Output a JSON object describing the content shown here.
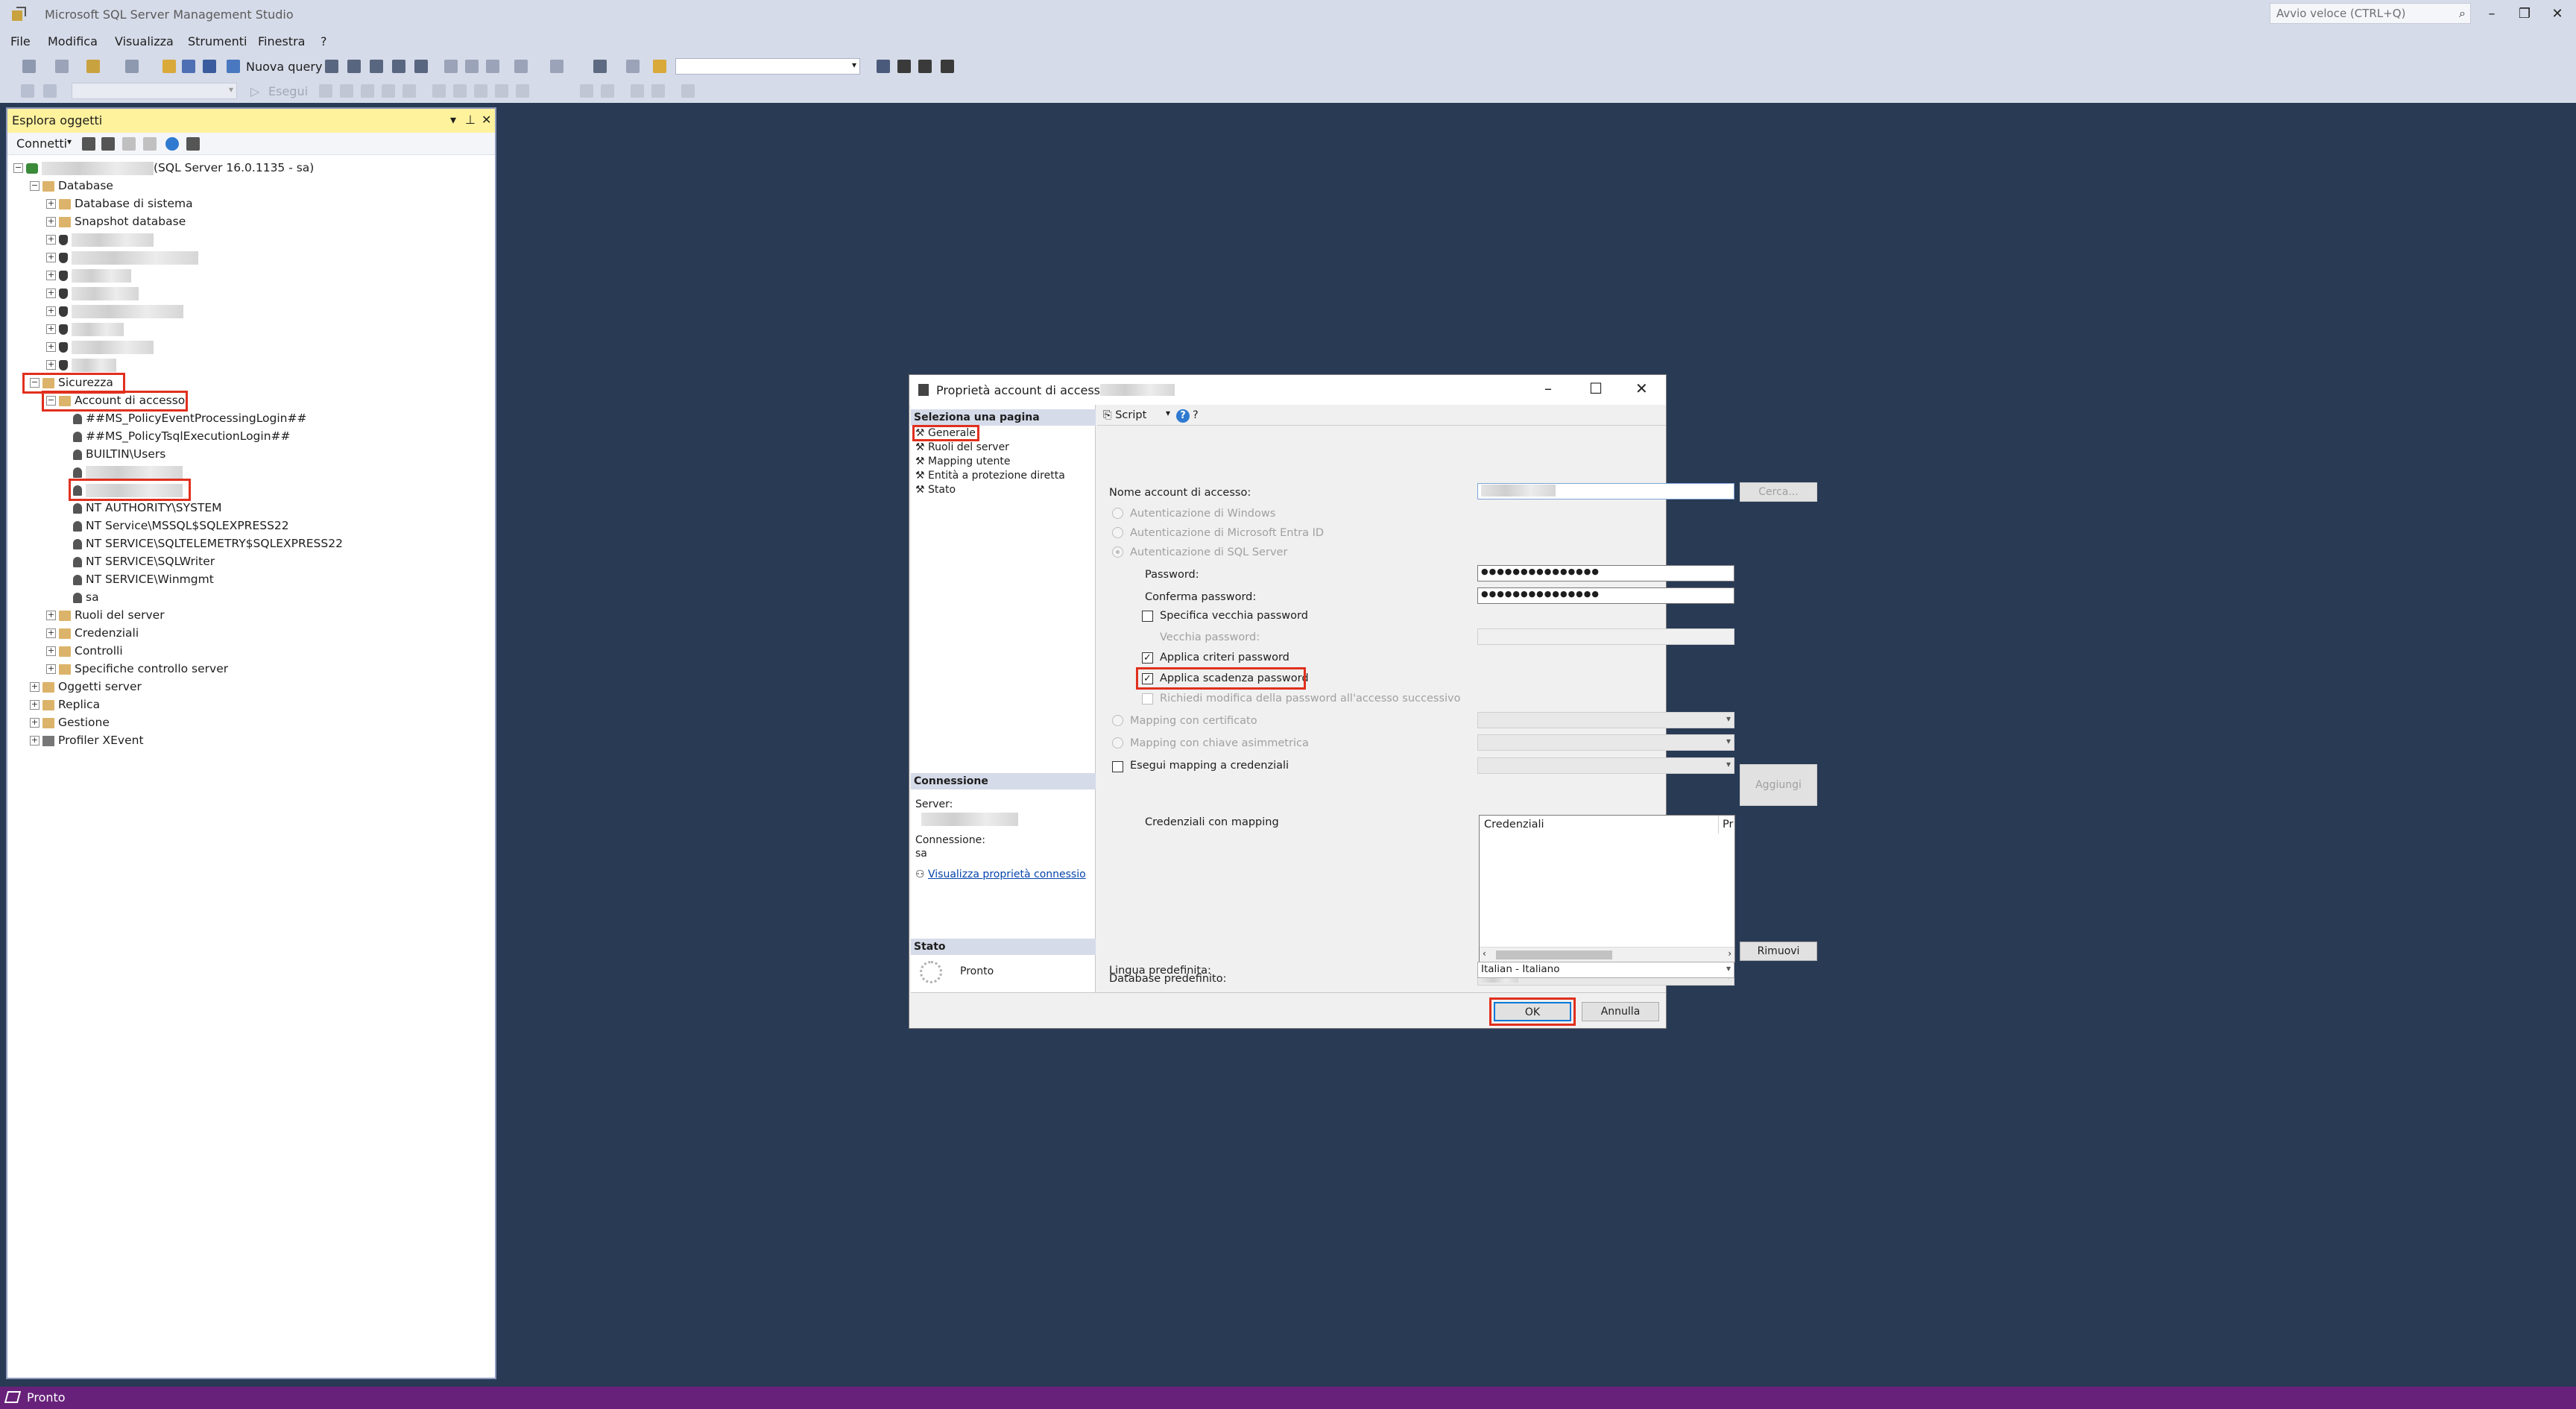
{
  "window": {
    "title": "Microsoft SQL Server Management Studio",
    "quick_launch_placeholder": "Avvio veloce (CTRL+Q)"
  },
  "menu": [
    "File",
    "Modifica",
    "Visualizza",
    "Strumenti",
    "Finestra",
    "?"
  ],
  "toolbar": {
    "new_query": "Nuova query",
    "execute": "Esegui"
  },
  "object_explorer": {
    "title": "Esplora oggetti",
    "connect": "Connetti",
    "server_suffix": "(SQL Server 16.0.1135 - sa)",
    "databases": "Database",
    "system_databases": "Database di sistema",
    "snapshot_databases": "Snapshot database",
    "security": "Sicurezza",
    "logins": "Account di accesso",
    "login_items": [
      "##MS_PolicyEventProcessingLogin##",
      "##MS_PolicyTsqlExecutionLogin##",
      "BUILTIN\\Users",
      "NT AUTHORITY\\SYSTEM",
      "NT Service\\MSSQL$SQLEXPRESS22",
      "NT SERVICE\\SQLTELEMETRY$SQLEXPRESS22",
      "NT SERVICE\\SQLWriter",
      "NT SERVICE\\Winmgmt",
      "sa"
    ],
    "security_children": [
      "Ruoli del server",
      "Credenziali",
      "Controlli",
      "Specifiche controllo server"
    ],
    "top_nodes": [
      "Oggetti server",
      "Replica",
      "Gestione",
      "Profiler XEvent"
    ]
  },
  "status_bar": "Pronto",
  "dialog": {
    "title": "Proprietà account di accesso -",
    "select_page": "Seleziona una pagina",
    "pages": [
      "Generale",
      "Ruoli del server",
      "Mapping utente",
      "Entità a protezione diretta",
      "Stato"
    ],
    "connection_header": "Connessione",
    "server_label": "Server:",
    "connection_label": "Connessione:",
    "connection_value": "sa",
    "view_props_link": "Visualizza proprietà connessio",
    "state_header": "Stato",
    "state_value": "Pronto",
    "script": "Script",
    "login_name_label": "Nome account di accesso:",
    "search_button": "Cerca...",
    "auth_windows": "Autenticazione di Windows",
    "auth_entra": "Autenticazione di Microsoft Entra ID",
    "auth_sql": "Autenticazione di SQL Server",
    "password_label": "Password:",
    "password_value": "●●●●●●●●●●●●●●●",
    "confirm_label": "Conferma password:",
    "confirm_value": "●●●●●●●●●●●●●●●",
    "specify_old": "Specifica vecchia password",
    "old_password": "Vecchia password:",
    "enforce_policy": "Applica criteri password",
    "enforce_expiration": "Applica scadenza password",
    "must_change": "Richiedi modifica della password all'accesso successivo",
    "mapped_cert": "Mapping con certificato",
    "mapped_key": "Mapping con chiave asimmetrica",
    "map_credential": "Esegui mapping a credenziali",
    "add_button": "Aggiungi",
    "mapped_credentials_label": "Credenziali con mapping",
    "grid_col1": "Credenziali",
    "grid_col2": "Pr",
    "remove_button": "Rimuovi",
    "default_db_label": "Database predefinito:",
    "default_lang_label": "Lingua predefinita:",
    "default_lang_value": "Italian - Italiano",
    "ok": "OK",
    "cancel": "Annulla"
  }
}
